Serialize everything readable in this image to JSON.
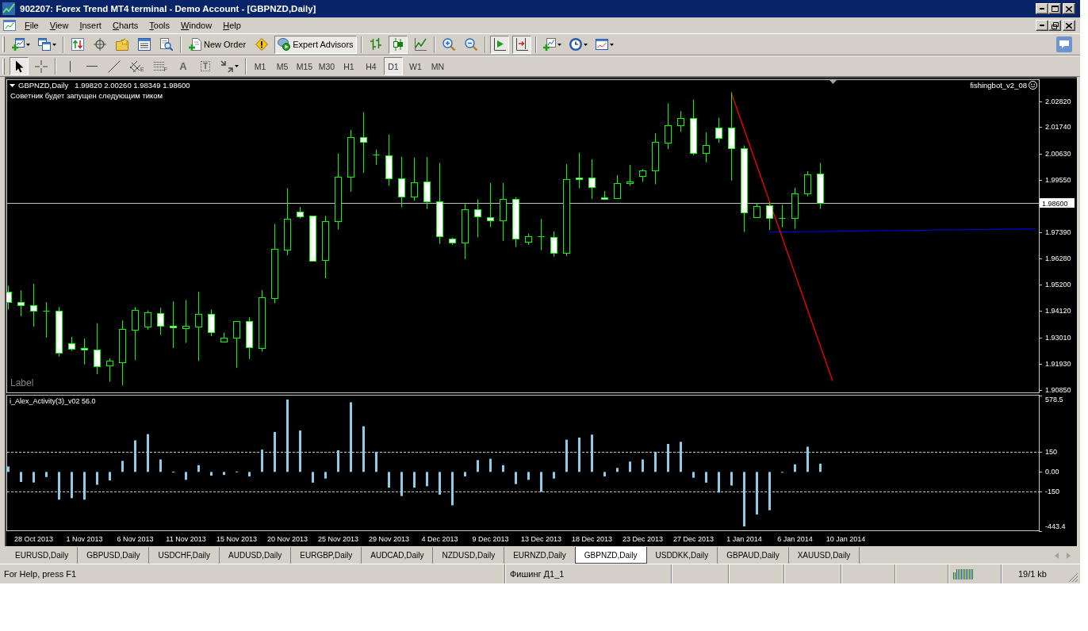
{
  "window": {
    "title": "902207: Forex Trend MT4 terminal - Demo Account - [GBPNZD,Daily]"
  },
  "menu": [
    "File",
    "View",
    "Insert",
    "Charts",
    "Tools",
    "Window",
    "Help"
  ],
  "toolbar": [
    [
      {
        "kind": "new-chart",
        "dropdown": true,
        "pressed": false
      },
      {
        "kind": "profiles",
        "dropdown": true,
        "pressed": false
      }
    ],
    [
      {
        "kind": "market-watch",
        "pressed": false
      },
      {
        "kind": "data-window",
        "pressed": false
      },
      {
        "kind": "navigator",
        "pressed": false
      },
      {
        "kind": "terminal",
        "pressed": false
      },
      {
        "kind": "tester",
        "pressed": false
      }
    ],
    [
      {
        "kind": "new-order",
        "label": "New Order",
        "pressed": false
      },
      {
        "kind": "editor",
        "pressed": false
      },
      {
        "kind": "experts",
        "label": "Expert Advisors",
        "pressed": true
      }
    ],
    [
      {
        "kind": "bar-chart",
        "pressed": false
      },
      {
        "kind": "candlesticks",
        "pressed": true
      },
      {
        "kind": "line-chart",
        "pressed": false
      }
    ],
    [
      {
        "kind": "zoom-in",
        "pressed": false
      },
      {
        "kind": "zoom-out",
        "pressed": false
      }
    ],
    [
      {
        "kind": "auto-scroll",
        "pressed": true
      },
      {
        "kind": "chart-shift",
        "pressed": true
      }
    ],
    [
      {
        "kind": "indicators",
        "dropdown": true,
        "pressed": false
      },
      {
        "kind": "periods",
        "dropdown": true,
        "pressed": false
      },
      {
        "kind": "templates",
        "dropdown": true,
        "pressed": false
      }
    ]
  ],
  "drawing_tools": [
    [
      {
        "kind": "cursor",
        "pressed": true
      },
      {
        "kind": "crosshair",
        "pressed": false
      }
    ],
    [
      {
        "kind": "vertical-line",
        "pressed": false
      },
      {
        "kind": "horizontal-line",
        "pressed": false
      },
      {
        "kind": "trendline",
        "pressed": false
      },
      {
        "kind": "channel",
        "glyph": "E",
        "pressed": false
      },
      {
        "kind": "fibonacci",
        "glyph": "F",
        "pressed": false
      },
      {
        "kind": "text",
        "glyph": "A",
        "pressed": false
      },
      {
        "kind": "text-label",
        "glyph": "T",
        "pressed": false
      },
      {
        "kind": "arrows",
        "dropdown": true,
        "pressed": false
      }
    ]
  ],
  "timeframes": [
    {
      "label": "M1",
      "selected": false
    },
    {
      "label": "M5",
      "selected": false
    },
    {
      "label": "M15",
      "selected": false
    },
    {
      "label": "M30",
      "selected": false
    },
    {
      "label": "H1",
      "selected": false
    },
    {
      "label": "H4",
      "selected": false
    },
    {
      "label": "D1",
      "selected": true
    },
    {
      "label": "W1",
      "selected": false
    },
    {
      "label": "MN",
      "selected": false
    }
  ],
  "chart": {
    "quote": "1.99820 2.00260 1.98349 1.98600",
    "comment": "Советник будет запущен следующим тиком",
    "expert": {
      "name": "fishingbot_v2_08",
      "active": true
    },
    "text_object": "Label",
    "chart_data": [
      {
        "type": "candlestick",
        "title": "GBPNZD,Daily",
        "tick_labels": "y",
        "ylim": [
          1.9072,
          2.0371
        ],
        "yticks": [
          {
            "value": 2.0282,
            "label": "2.02820"
          },
          {
            "value": 2.0174,
            "label": "2.01740"
          },
          {
            "value": 2.0063,
            "label": "2.00630"
          },
          {
            "value": 1.9955,
            "label": "1.99550"
          },
          {
            "value": 1.9739,
            "label": "1.97390"
          },
          {
            "value": 1.9628,
            "label": "1.96280"
          },
          {
            "value": 1.952,
            "label": "1.95200"
          },
          {
            "value": 1.9412,
            "label": "1.94120"
          },
          {
            "value": 1.9301,
            "label": "1.93010"
          },
          {
            "value": 1.9193,
            "label": "1.91930"
          },
          {
            "value": 1.9085,
            "label": "1.90850"
          }
        ],
        "ref_lines": [
          {
            "axis": "y",
            "value": 1.986,
            "label": "1.98600",
            "color": "#c0c0c0"
          }
        ],
        "series": [
          {
            "type": "candlestick",
            "color": "#00ff00",
            "ohlc": [
              [
                1.9491,
                1.9516,
                1.9418,
                1.9447
              ],
              [
                1.9447,
                1.9497,
                1.939,
                1.9437
              ],
              [
                1.9435,
                1.9524,
                1.9347,
                1.9414
              ],
              [
                1.9414,
                1.9448,
                1.9301,
                1.9414
              ],
              [
                1.9414,
                1.9428,
                1.9222,
                1.9237
              ],
              [
                1.9278,
                1.9304,
                1.9246,
                1.9255
              ],
              [
                1.9258,
                1.9297,
                1.919,
                1.9252
              ],
              [
                1.9252,
                1.9361,
                1.9149,
                1.9183
              ],
              [
                1.9184,
                1.9215,
                1.9118,
                1.9204
              ],
              [
                1.92,
                1.9372,
                1.9103,
                1.9336
              ],
              [
                1.9334,
                1.9427,
                1.9208,
                1.9415
              ],
              [
                1.9347,
                1.9414,
                1.9334,
                1.9405
              ],
              [
                1.9402,
                1.9425,
                1.9312,
                1.9351
              ],
              [
                1.9349,
                1.9451,
                1.9258,
                1.9344
              ],
              [
                1.9341,
                1.9457,
                1.9279,
                1.9349
              ],
              [
                1.9348,
                1.9491,
                1.9204,
                1.94
              ],
              [
                1.94,
                1.9417,
                1.9307,
                1.9322
              ],
              [
                1.9284,
                1.9322,
                1.928,
                1.93
              ],
              [
                1.9301,
                1.9368,
                1.9175,
                1.9368
              ],
              [
                1.9371,
                1.9385,
                1.9212,
                1.9262
              ],
              [
                1.9258,
                1.9498,
                1.9243,
                1.9467
              ],
              [
                1.9465,
                1.9772,
                1.9444,
                1.9669
              ],
              [
                1.9667,
                1.9921,
                1.9642,
                1.9793
              ],
              [
                1.9824,
                1.9843,
                1.9796,
                1.9805
              ],
              [
                1.9806,
                1.9806,
                1.9617,
                1.962
              ],
              [
                1.9624,
                1.9806,
                1.9547,
                1.9783
              ],
              [
                1.9783,
                2.0064,
                1.9749,
                1.9968
              ],
              [
                1.9968,
                2.0163,
                1.9906,
                2.0132
              ],
              [
                2.0131,
                2.0236,
                1.9984,
                2.0113
              ],
              [
                2.0059,
                2.0081,
                2.0017,
                2.0059
              ],
              [
                2.0056,
                2.0143,
                1.9931,
                1.9963
              ],
              [
                1.9963,
                2.0051,
                1.9842,
                1.9885
              ],
              [
                1.9885,
                2.0047,
                1.9869,
                1.9945
              ],
              [
                1.9948,
                2.005,
                1.9835,
                1.9865
              ],
              [
                1.9866,
                2.0026,
                1.969,
                1.972
              ],
              [
                1.971,
                1.9716,
                1.9686,
                1.9694
              ],
              [
                1.9694,
                1.9856,
                1.9627,
                1.9832
              ],
              [
                1.9832,
                1.9875,
                1.9717,
                1.9803
              ],
              [
                1.9802,
                1.9942,
                1.976,
                1.9787
              ],
              [
                1.9787,
                1.9942,
                1.9703,
                1.9875
              ],
              [
                1.9875,
                1.9883,
                1.9677,
                1.9711
              ],
              [
                1.9697,
                1.9732,
                1.9686,
                1.972
              ],
              [
                1.9721,
                1.9793,
                1.9664,
                1.9721
              ],
              [
                1.9717,
                1.9742,
                1.9637,
                1.9654
              ],
              [
                1.9654,
                2.0021,
                1.9639,
                1.9957
              ],
              [
                1.9966,
                2.0068,
                1.9921,
                1.9957
              ],
              [
                1.9964,
                2.0041,
                1.9876,
                1.9925
              ],
              [
                1.9883,
                1.9909,
                1.9874,
                1.9875
              ],
              [
                1.9878,
                1.9975,
                1.9876,
                1.9941
              ],
              [
                1.9941,
                2.0018,
                1.993,
                1.9949
              ],
              [
                1.9973,
                2.0,
                1.9948,
                1.9993
              ],
              [
                1.9993,
                2.0149,
                1.9937,
                2.0113
              ],
              [
                2.0109,
                2.0272,
                2.0082,
                2.0182
              ],
              [
                2.0182,
                2.024,
                2.0155,
                2.0211
              ],
              [
                2.0211,
                2.0288,
                2.0058,
                2.0066
              ],
              [
                2.0066,
                2.0152,
                2.0028,
                2.01
              ],
              [
                2.0173,
                2.0213,
                2.0109,
                2.0128
              ],
              [
                2.0173,
                2.0318,
                1.9953,
                2.0087
              ],
              [
                2.0087,
                2.0098,
                1.9739,
                1.982
              ],
              [
                1.9802,
                1.986,
                1.98,
                1.9847
              ],
              [
                1.9849,
                1.9863,
                1.9747,
                1.9796
              ],
              [
                1.9798,
                1.9852,
                1.9758,
                1.9798
              ],
              [
                1.9798,
                1.9923,
                1.9752,
                1.9898
              ],
              [
                1.9898,
                1.9991,
                1.9887,
                1.9977
              ],
              [
                1.9982,
                2.0026,
                1.98349,
                1.986
              ]
            ]
          },
          {
            "type": "line",
            "color": "#0000c8",
            "values": [
              null,
              null,
              null,
              null,
              null,
              null,
              null,
              null,
              null,
              null,
              null,
              null,
              null,
              null,
              null,
              null,
              null,
              null,
              null,
              null,
              null,
              null,
              null,
              null,
              null,
              null,
              null,
              null,
              null,
              null,
              null,
              null,
              null,
              null,
              null,
              null,
              null,
              null,
              null,
              null,
              null,
              null,
              null,
              null,
              null,
              null,
              null,
              null,
              null,
              null,
              null,
              null,
              null,
              null,
              null,
              null,
              null,
              null,
              null,
              null,
              1.9739,
              1.974,
              1.974,
              1.9741,
              1.9741,
              1.9742,
              1.9743,
              1.9743,
              1.9744,
              1.9745,
              1.9745,
              1.9746,
              1.9746,
              1.9747,
              1.9748,
              1.9748,
              1.9749,
              1.9749,
              1.975,
              1.9751,
              1.9751,
              1.9752
            ]
          },
          {
            "type": "line",
            "color": "#ff0000",
            "values": [
              null,
              null,
              null,
              null,
              null,
              null,
              null,
              null,
              null,
              null,
              null,
              null,
              null,
              null,
              null,
              null,
              null,
              null,
              null,
              null,
              null,
              null,
              null,
              null,
              null,
              null,
              null,
              null,
              null,
              null,
              null,
              null,
              null,
              null,
              null,
              null,
              null,
              null,
              null,
              null,
              null,
              null,
              null,
              null,
              null,
              null,
              null,
              null,
              null,
              null,
              null,
              null,
              null,
              null,
              null,
              null,
              null,
              2.0318,
              2.0168,
              2.0019,
              1.9869,
              1.972,
              1.957,
              1.942,
              1.9271,
              1.9121,
              null,
              null,
              null,
              null,
              null,
              null,
              null,
              null,
              null,
              null,
              null,
              null,
              null,
              null,
              null,
              null
            ]
          }
        ]
      },
      {
        "type": "bar",
        "title": "i_Alex_Activity(3)_v02 56.0",
        "color": "#87ceeb",
        "ylim": [
          -443.4,
          578.5
        ],
        "yticks": [
          {
            "value": 578.5,
            "label": "578.5"
          },
          150,
          {
            "value": 0,
            "label": "0.00"
          },
          -150,
          {
            "value": -443.4,
            "label": "-443.4"
          }
        ],
        "ref_lines": [
          {
            "axis": "y",
            "value": 150,
            "color": "#c0c0c0",
            "line_style": "dashed"
          },
          {
            "axis": "y",
            "value": -150,
            "color": "#c0c0c0",
            "line_style": "dashed"
          }
        ],
        "categories": [
          null,
          null,
          "28 Oct 2013",
          null,
          null,
          null,
          "1 Nov 2013",
          null,
          null,
          null,
          "6 Nov 2013",
          null,
          null,
          null,
          "11 Nov 2013",
          null,
          null,
          null,
          "15 Nov 2013",
          null,
          null,
          null,
          "20 Nov 2013",
          null,
          null,
          null,
          "25 Nov 2013",
          null,
          null,
          null,
          "29 Nov 2013",
          null,
          null,
          null,
          "4 Dec 2013",
          null,
          null,
          null,
          "9 Dec 2013",
          null,
          null,
          null,
          "13 Dec 2013",
          null,
          null,
          null,
          "18 Dec 2013",
          null,
          null,
          null,
          "23 Dec 2013",
          null,
          null,
          null,
          "27 Dec 2013",
          null,
          null,
          null,
          "1 Jan 2014",
          null,
          null,
          null,
          "6 Jan 2014",
          null,
          null,
          null,
          "10 Jan 2014",
          null,
          null,
          null,
          null,
          null,
          null,
          null,
          null,
          null,
          null,
          null,
          null,
          null,
          null,
          null
        ],
        "values": [
          41,
          -76,
          -80,
          -39,
          -209,
          -198,
          -209,
          -97,
          -65,
          83,
          238,
          285,
          94,
          2,
          -60,
          51,
          -28,
          -23,
          3,
          -34,
          168,
          301,
          546,
          312,
          -81,
          -50,
          163,
          525,
          344,
          152,
          -119,
          -182,
          -119,
          -108,
          -172,
          -252,
          -34,
          89,
          99,
          51,
          -92,
          -60,
          -151,
          -50,
          243,
          259,
          281,
          -34,
          30,
          78,
          94,
          152,
          211,
          227,
          -44,
          -81,
          -156,
          -103,
          -411,
          -321,
          -289,
          -2,
          57,
          190,
          62,
          null,
          null,
          null,
          null,
          null,
          null,
          null,
          null,
          null,
          null,
          null,
          null,
          null,
          null,
          null,
          null,
          null
        ]
      }
    ]
  },
  "tabs": [
    {
      "label": "EURUSD,Daily",
      "selected": false
    },
    {
      "label": "GBPUSD,Daily",
      "selected": false
    },
    {
      "label": "USDCHF,Daily",
      "selected": false
    },
    {
      "label": "AUDUSD,Daily",
      "selected": false
    },
    {
      "label": "EURGBP,Daily",
      "selected": false
    },
    {
      "label": "AUDCAD,Daily",
      "selected": false
    },
    {
      "label": "NZDUSD,Daily",
      "selected": false
    },
    {
      "label": "EURNZD,Daily",
      "selected": false
    },
    {
      "label": "GBPNZD,Daily",
      "selected": true
    },
    {
      "label": "USDDKK,Daily",
      "selected": false
    },
    {
      "label": "GBPAUD,Daily",
      "selected": false
    },
    {
      "label": "XAUUSD,Daily",
      "selected": false
    }
  ],
  "status_bar": {
    "help": "For Help, press F1",
    "profile": "Фишинг Д1_1",
    "traffic": "19/1 kb"
  }
}
